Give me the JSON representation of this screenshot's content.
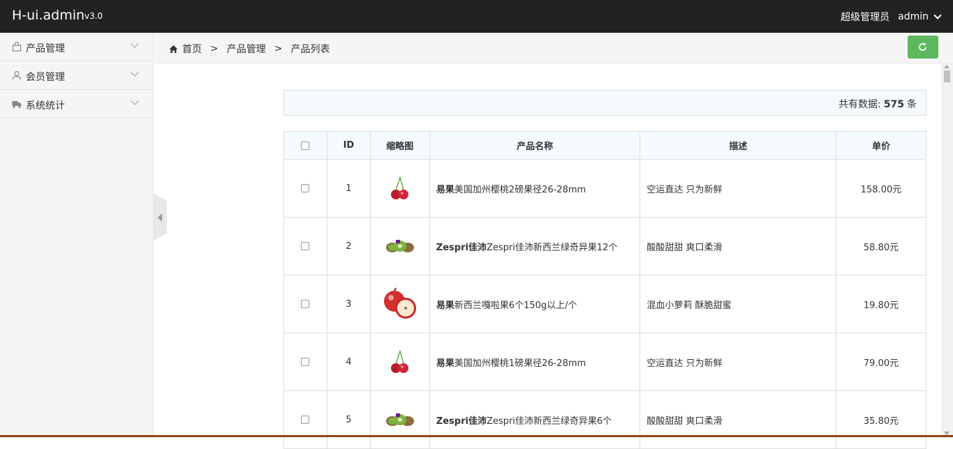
{
  "header": {
    "brand": "H-ui.admin",
    "version": "v3.0",
    "role": "超级管理员",
    "username": "admin"
  },
  "sidebar": {
    "items": [
      {
        "label": "产品管理",
        "icon": "bag-icon"
      },
      {
        "label": "会员管理",
        "icon": "user-icon"
      },
      {
        "label": "系统统计",
        "icon": "truck-icon"
      }
    ]
  },
  "breadcrumb": {
    "home": "首页",
    "sep1": ">",
    "level1": "产品管理",
    "sep2": ">",
    "level2": "产品列表"
  },
  "summary": {
    "prefix": "共有数据:",
    "count": "575",
    "suffix": "条"
  },
  "table": {
    "headers": {
      "id": "ID",
      "thumb": "缩略图",
      "name": "产品名称",
      "desc": "描述",
      "price": "单价"
    },
    "rows": [
      {
        "id": "1",
        "brand": "易果",
        "name": "美国加州樱桃2磅果径26-28mm",
        "desc": "空运直达 只为新鲜",
        "price": "158.00元",
        "image": "cherry"
      },
      {
        "id": "2",
        "brand": "Zespri佳沛",
        "name": "Zespri佳沛新西兰绿奇异果12个",
        "desc": "酸酸甜甜 爽口柔滑",
        "price": "58.80元",
        "image": "kiwi"
      },
      {
        "id": "3",
        "brand": "易果",
        "name": "新西兰嘎啦果6个150g以上/个",
        "desc": "混血小萝莉 酥脆甜蜜",
        "price": "19.80元",
        "image": "apple"
      },
      {
        "id": "4",
        "brand": "易果",
        "name": "美国加州樱桃1磅果径26-28mm",
        "desc": "空运直达 只为新鲜",
        "price": "79.00元",
        "image": "cherry"
      },
      {
        "id": "5",
        "brand": "Zespri佳沛",
        "name": "Zespri佳沛新西兰绿奇异果6个",
        "desc": "酸酸甜甜 爽口柔滑",
        "price": "35.80元",
        "image": "kiwi"
      }
    ]
  }
}
